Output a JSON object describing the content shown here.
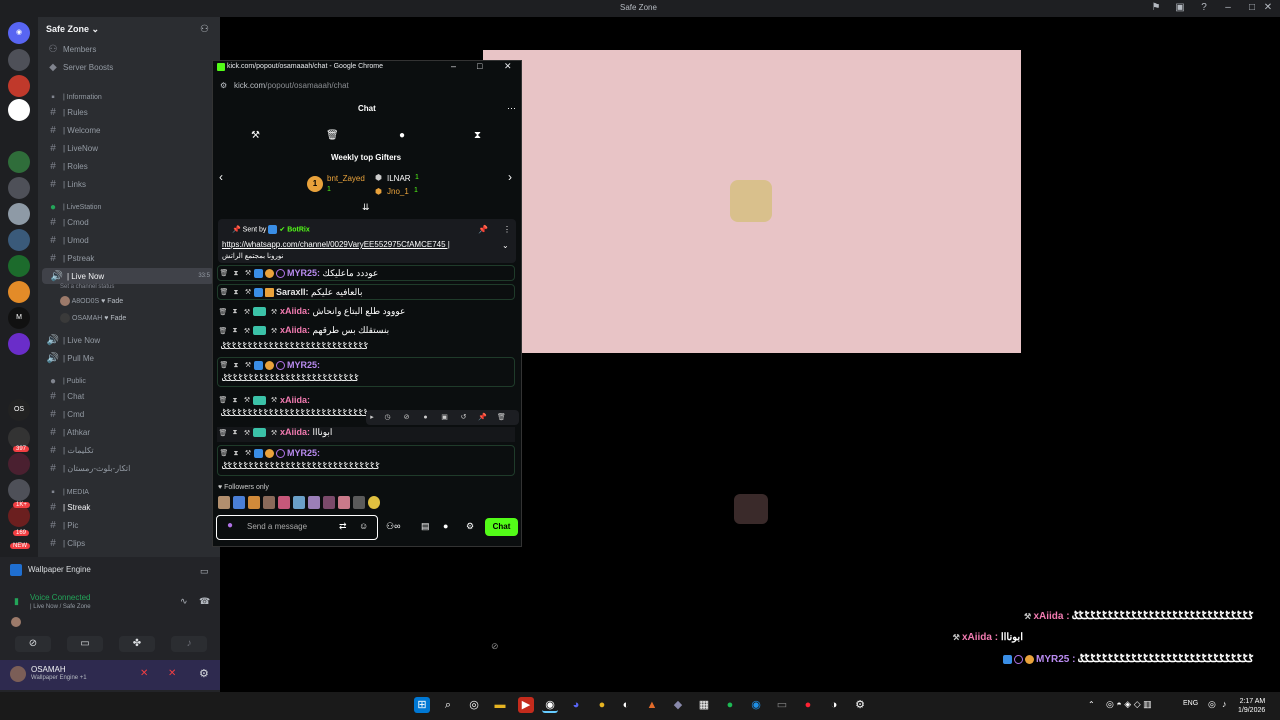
{
  "app": {
    "title": "Safe Zone"
  },
  "discord": {
    "server_name": "Safe Zone",
    "top_items": [
      "Members",
      "Server Boosts"
    ],
    "categories": {
      "information": "| Information",
      "livestation": "| LiveStation",
      "public": "| Public",
      "media": "| MEDIA"
    },
    "channels_info": [
      "| Rules",
      "| Welcome",
      "| LiveNow",
      "| Roles",
      "| Links"
    ],
    "channels_live": [
      "| Cmod",
      "| Umod",
      "| Pstreak",
      "| Live Now"
    ],
    "live_now_time": "33:5",
    "channel_status": "Set a channel status",
    "voice_users": [
      {
        "name": "A8OD0S",
        "tag": "Fade"
      },
      {
        "name": "OSAMAH",
        "tag": "Fade"
      }
    ],
    "channels_voice": [
      "| Live Now",
      "| Pull Me"
    ],
    "channels_public": [
      "| Chat",
      "| Cmd",
      "| Athkar",
      "| تكليمات",
      "| اتكار-بلوث-رمستان"
    ],
    "channels_media": [
      "| Streak",
      "| Pic",
      "| Clips"
    ],
    "guild_badges": [
      "397",
      "1K+",
      "169",
      "NEW"
    ],
    "wallpaper_engine": "Wallpaper Engine",
    "voice_connected": "Voice Connected",
    "voice_sub": "| Live Now / Safe Zone",
    "user_name": "OSAMAH",
    "user_status": "Wallpaper Engine +1"
  },
  "popup": {
    "window_title": "kick.com/popout/osamaaah/chat - Google Chrome",
    "address_host": "kick.com",
    "address_path": "/popout/osamaaah/chat",
    "header": "Chat",
    "gifters_title": "Weekly top Gifters",
    "gifters": [
      {
        "rank": "1",
        "name": "bnt_Zayed",
        "count": "1"
      },
      {
        "rank": "",
        "name": "ILNAR",
        "count": "1"
      },
      {
        "rank": "",
        "name": "Jno_1",
        "count": "1"
      }
    ],
    "pinned": {
      "sent_by": "Sent by",
      "bot": "BotRix",
      "link": "https://whatsapp.com/channel/0029VaryEE552975CfAMCE745 |",
      "text": "نورونا بمجتمع الراتش"
    },
    "messages": [
      {
        "user": "MYR25:",
        "text": "عوددد ماعليكك",
        "color": "#b98bf0"
      },
      {
        "user": "SaraxII:",
        "text": "بالعافيه عليكم",
        "color": "#e6e6e6"
      },
      {
        "user": "xAiida:",
        "text": "عووود طلع البتاع وانحاش",
        "color": "#f27bb1"
      },
      {
        "user": "xAiida:",
        "text": "بنستقلك بس طرقهم",
        "color": "#f27bb1"
      },
      {
        "user": "",
        "text": "ݣݣݣݣݣݣݣݣݣݣݣݣݣݣݣݣݣݣݣݣݣݣݣݣݣݣݣݣ",
        "color": "#fff"
      },
      {
        "user": "MYR25:",
        "text": "ݣݣݣݣݣݣݣݣݣݣݣݣݣݣݣݣݣݣݣݣݣݣݣݣݣݣ",
        "color": "#b98bf0"
      },
      {
        "user": "xAiida:",
        "text": "ݣݣݣݣݣݣݣݣݣݣݣݣݣݣݣݣݣݣݣݣݣݣݣݣݣݣݣݣ",
        "color": "#f27bb1"
      },
      {
        "user": "xAiida:",
        "text": "ابونااا",
        "color": "#f27bb1"
      },
      {
        "user": "MYR25:",
        "text": "ݣݣݣݣݣݣݣݣݣݣݣݣݣݣݣݣݣݣݣݣݣݣݣݣݣݣݣݣݣݣ",
        "color": "#b98bf0"
      }
    ],
    "followers_only": "Followers only",
    "input_placeholder": "Send a message",
    "send_label": "Chat"
  },
  "overlay": [
    {
      "user": "xAiida :",
      "text": "ݣݣݣݣݣݣݣݣݣݣݣݣݣݣݣݣݣݣݣݣݣݣݣݣݣݣݣݣݣݣݣ",
      "color": "#f27bb1"
    },
    {
      "user": "xAiida :",
      "text": "ابونااا",
      "color": "#f27bb1"
    },
    {
      "user": "MYR25 :",
      "text": "ݣݣݣݣݣݣݣݣݣݣݣݣݣݣݣݣݣݣݣݣݣݣݣݣݣݣݣݣݣݣ",
      "color": "#b98bf0"
    }
  ],
  "taskbar": {
    "lang": "ENG",
    "time": "2:17 AM",
    "date": "1/9/2026"
  }
}
